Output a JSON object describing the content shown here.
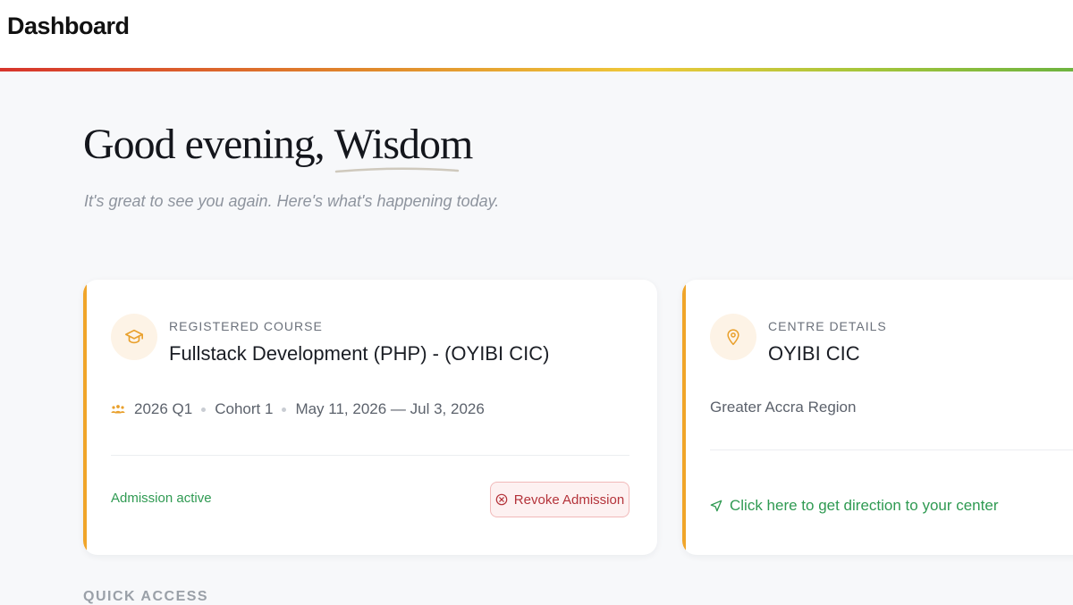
{
  "header": {
    "title": "Dashboard"
  },
  "greeting": {
    "prefix": "Good evening,",
    "name": "Wisdom",
    "subtitle": "It's great to see you again. Here's what's happening today."
  },
  "course_card": {
    "label": "REGISTERED COURSE",
    "course_name": "Fullstack Development (PHP) - (OYIBI CIC)",
    "icon": "graduation-cap-icon",
    "period": "2026 Q1",
    "cohort": "Cohort 1",
    "dates": "May 11, 2026 — Jul 3, 2026",
    "status": "Admission active",
    "revoke_label": "Revoke Admission"
  },
  "centre_card": {
    "label": "CENTRE DETAILS",
    "centre_name": "OYIBI CIC",
    "icon": "map-pin-icon",
    "region": "Greater Accra Region",
    "direction_label": "Click here to get direction to your center"
  },
  "sections": {
    "quick_access": "QUICK ACCESS"
  },
  "colors": {
    "accent_orange": "#f0a52a",
    "success_green": "#2f9a52",
    "danger_red": "#b4333a"
  }
}
